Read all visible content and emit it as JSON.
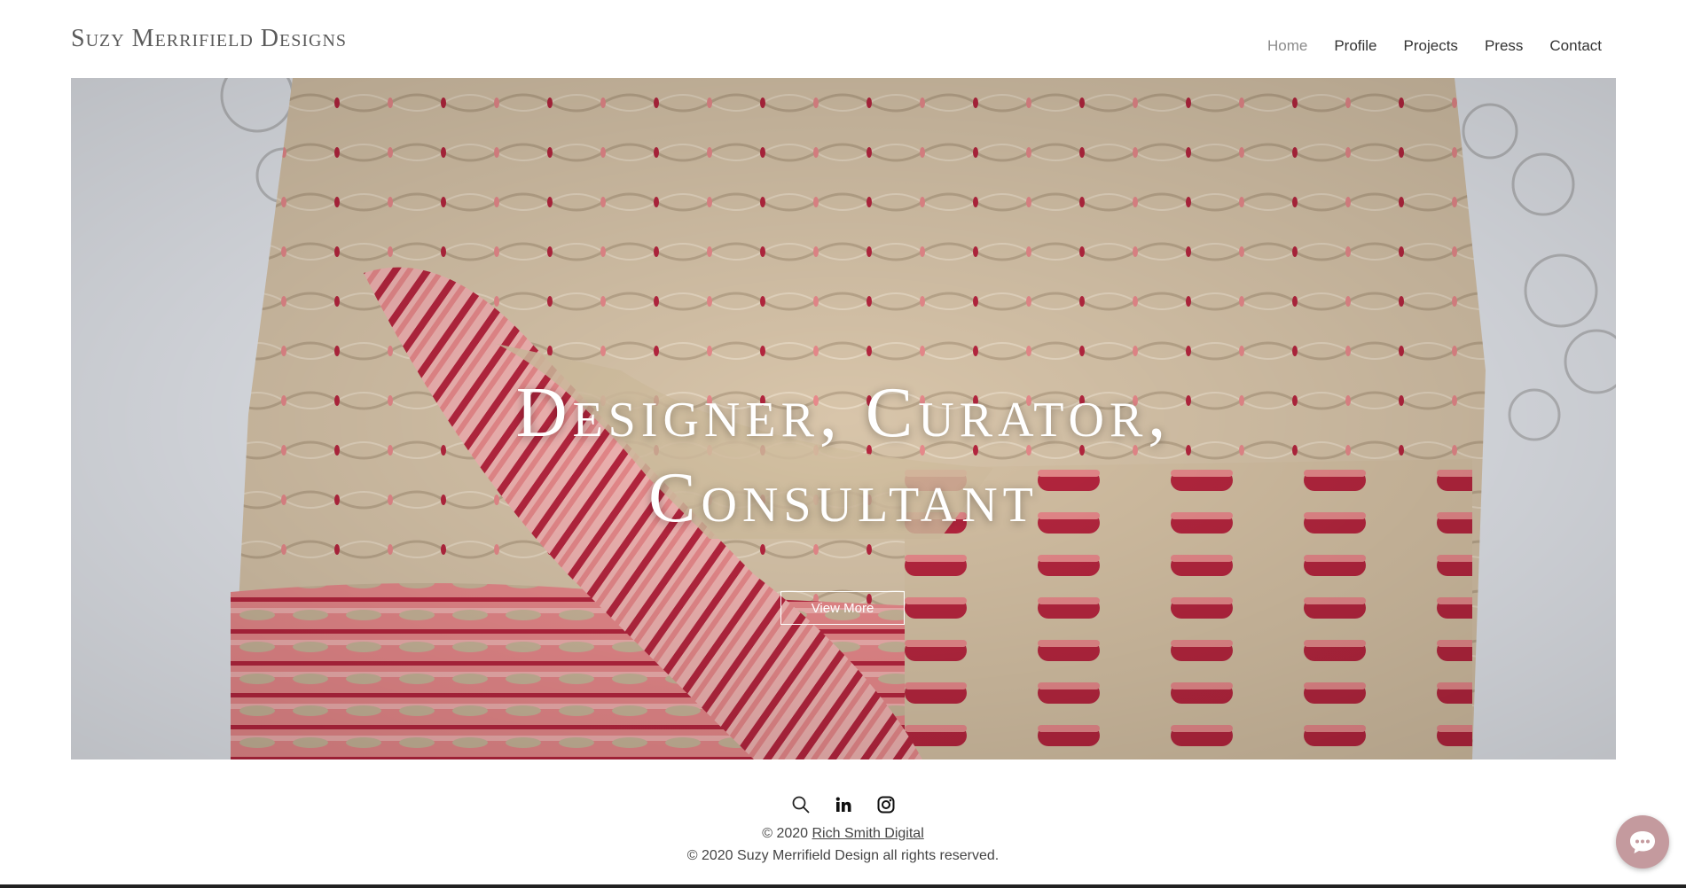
{
  "site": {
    "title": "Suzy Merrifield Designs"
  },
  "nav": {
    "items": [
      {
        "label": "Home",
        "active": true
      },
      {
        "label": "Profile"
      },
      {
        "label": "Projects"
      },
      {
        "label": "Press"
      },
      {
        "label": "Contact"
      }
    ]
  },
  "hero": {
    "title_line1": "Designer, Curator,",
    "title_line2": "Consultant",
    "button_label": "View More"
  },
  "footer": {
    "icons": [
      "search-icon",
      "linkedin-icon",
      "instagram-icon"
    ],
    "credit_prefix": "© 2020 ",
    "credit_link": "Rich Smith Digital",
    "copyright": "© 2020 Suzy Merrifield Design all rights reserved."
  },
  "chat": {
    "icon": "chat-bubble-icon",
    "color": "#c49a9e"
  },
  "colors": {
    "knit_beige": "#d9c6ab",
    "knit_pink": "#e98a8c",
    "knit_red": "#b7263f",
    "backdrop": "#e6e9ef"
  }
}
